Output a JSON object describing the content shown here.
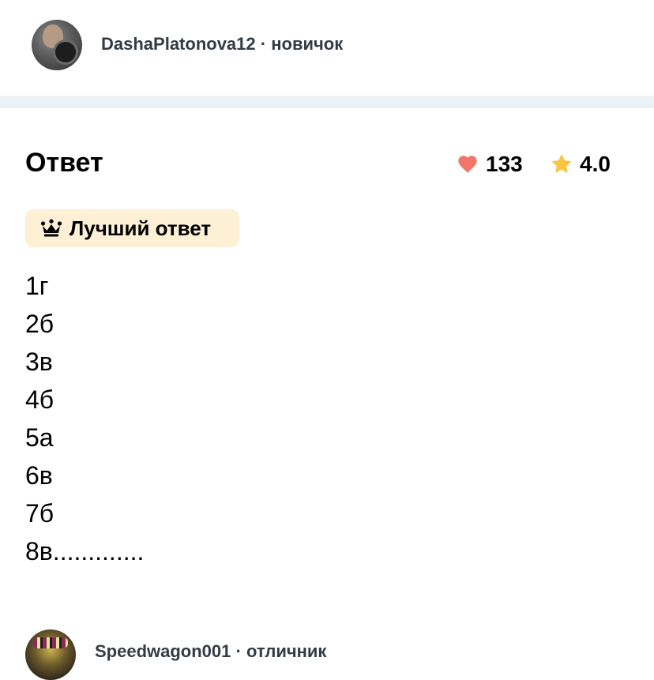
{
  "top_answer_author": {
    "username": "DashaPlatonova12",
    "separator": "·",
    "rank": "новичок"
  },
  "answer": {
    "heading": "Ответ",
    "likes": "133",
    "rating": "4.0",
    "best_label": "Лучший ответ",
    "lines": [
      "1г",
      "2б",
      "3в",
      "4б",
      "5а",
      "6в",
      "7б",
      "8в............."
    ]
  },
  "next_answer_author": {
    "username": "Speedwagon001",
    "separator": "·",
    "rank": "отличник"
  },
  "icons": {
    "avatar_top": "user-avatar-photo",
    "like": "heart-icon",
    "rating": "star-icon",
    "best": "crown-icon",
    "avatar_bottom": "user-avatar-photo"
  },
  "colors": {
    "heart": "#f0776a",
    "star": "#fbc53f",
    "badge_bg": "#fdf0d4",
    "separator_bg": "#ebf2f7",
    "author_text": "#323c45"
  }
}
